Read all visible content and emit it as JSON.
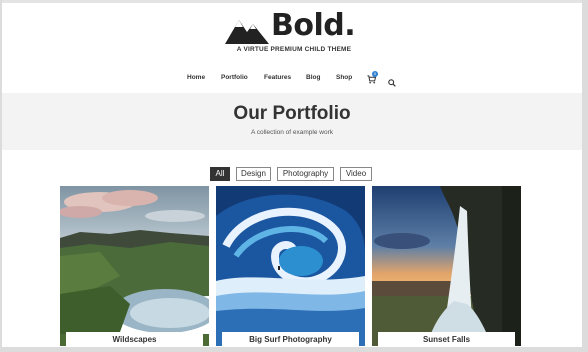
{
  "brand": {
    "name": "Bold.",
    "tagline": "A VIRTUE PREMIUM CHILD THEME"
  },
  "nav": {
    "items": [
      "Home",
      "Portfolio",
      "Features",
      "Blog",
      "Shop"
    ],
    "cart_count": "0"
  },
  "hero": {
    "title": "Our Portfolio",
    "subtitle": "A collection of example work"
  },
  "filters": {
    "items": [
      "All",
      "Design",
      "Photography",
      "Video"
    ],
    "active": "All"
  },
  "portfolio": {
    "items": [
      {
        "caption": "Wildscapes"
      },
      {
        "caption": "Big Surf Photography"
      },
      {
        "caption": "Sunset Falls"
      }
    ]
  },
  "icons": {
    "logo": "mountain-logo-icon",
    "cart": "cart-icon",
    "search": "search-icon"
  },
  "colors": {
    "text": "#333333",
    "hero_bg": "#f3f3f3",
    "active_filter_bg": "#333333",
    "badge": "#2d7fd0"
  }
}
